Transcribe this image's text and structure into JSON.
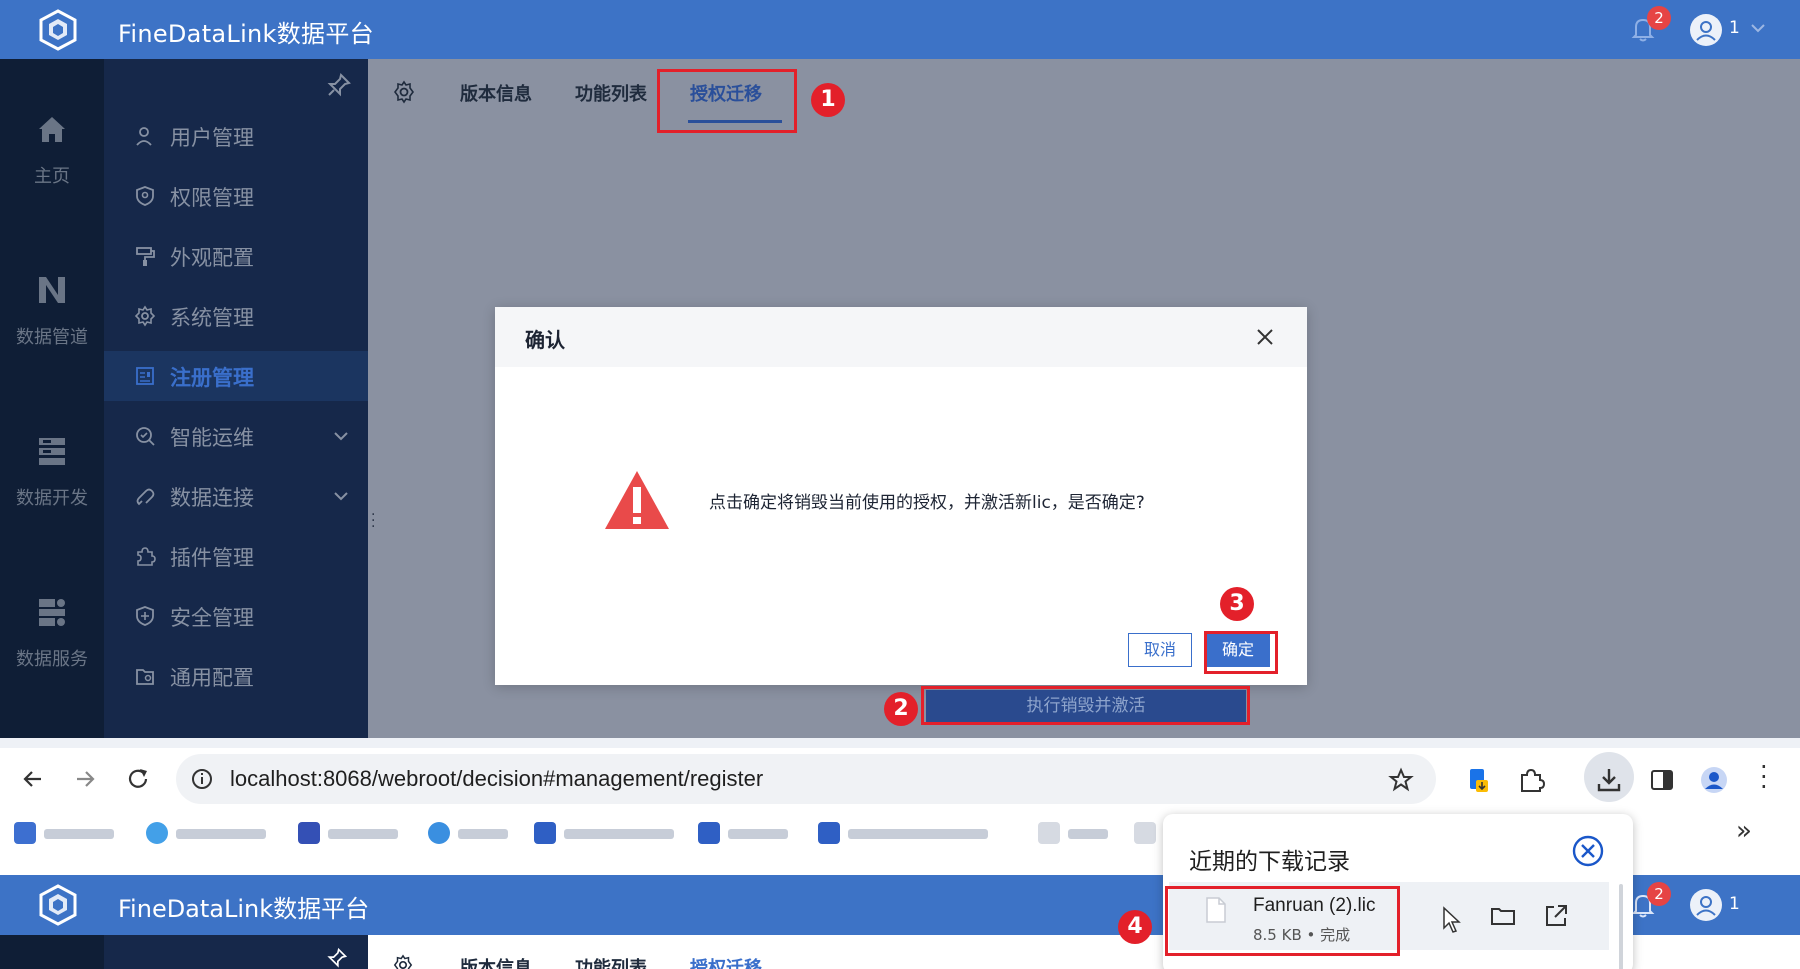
{
  "app": {
    "title": "FineDataLink数据平台",
    "notification_count": "2",
    "user_label": "1"
  },
  "rail": [
    {
      "label": "主页",
      "icon": "home-icon"
    },
    {
      "label": "数据管道",
      "icon": "pipeline-icon"
    },
    {
      "label": "数据开发",
      "icon": "dev-icon"
    },
    {
      "label": "数据服务",
      "icon": "service-icon"
    }
  ],
  "menu": [
    {
      "label": "用户管理",
      "icon": "user-icon"
    },
    {
      "label": "权限管理",
      "icon": "permission-icon"
    },
    {
      "label": "外观配置",
      "icon": "paint-icon"
    },
    {
      "label": "系统管理",
      "icon": "gear-icon"
    },
    {
      "label": "注册管理",
      "icon": "register-icon",
      "active": true
    },
    {
      "label": "智能运维",
      "icon": "ops-icon",
      "expandable": true
    },
    {
      "label": "数据连接",
      "icon": "link-icon",
      "expandable": true
    },
    {
      "label": "插件管理",
      "icon": "plugin-icon"
    },
    {
      "label": "安全管理",
      "icon": "shield-icon"
    },
    {
      "label": "通用配置",
      "icon": "config-icon"
    }
  ],
  "tabs": [
    {
      "label": "版本信息"
    },
    {
      "label": "功能列表"
    },
    {
      "label": "授权迁移",
      "active": true
    }
  ],
  "steps": [
    "1",
    "2",
    "3",
    "4"
  ],
  "dialog": {
    "title": "确认",
    "message": "点击确定将销毁当前使用的授权，并激活新lic，是否确定?",
    "cancel_label": "取消",
    "ok_label": "确定"
  },
  "exec_button_label": "执行销毁并激活",
  "browser": {
    "url": "localhost:8068/webroot/decision#management/register"
  },
  "downloads": {
    "title": "近期的下载记录",
    "items": [
      {
        "name": "Fanruan (2).lic",
        "meta": "8.5 KB • 完成"
      }
    ]
  },
  "colors": {
    "header_blue": "#3d73c6",
    "highlight_red": "#e3202a",
    "primary_blue": "#3a6fcb"
  }
}
